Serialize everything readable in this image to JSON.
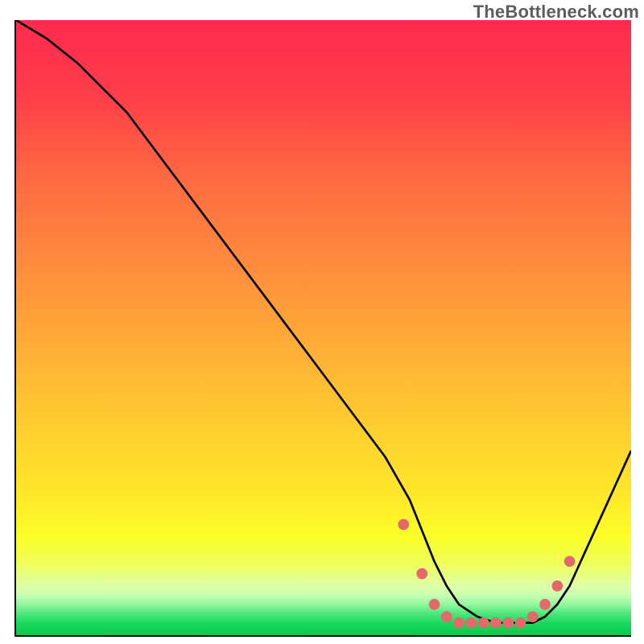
{
  "attribution": "TheBottleneck.com",
  "chart_data": {
    "type": "line",
    "title": "",
    "xlabel": "",
    "ylabel": "",
    "xlim": [
      0,
      100
    ],
    "ylim": [
      0,
      100
    ],
    "series": [
      {
        "name": "curve",
        "x": [
          0,
          5,
          10,
          18,
          30,
          45,
          60,
          64,
          68,
          70,
          72,
          75,
          78,
          80,
          82,
          84,
          86,
          88,
          90,
          100
        ],
        "values": [
          100,
          97,
          93,
          85,
          69,
          49,
          29,
          22,
          12,
          8,
          5,
          3,
          2,
          2,
          2,
          2,
          3,
          5,
          8,
          30
        ]
      }
    ],
    "markers": {
      "name": "salmon-dots",
      "x": [
        63,
        66,
        68,
        70,
        72,
        74,
        76,
        78,
        80,
        82,
        84,
        86,
        88,
        90
      ],
      "values": [
        18,
        10,
        5,
        3,
        2,
        2,
        2,
        2,
        2,
        2,
        3,
        5,
        8,
        12
      ]
    },
    "background": {
      "type": "vertical-gradient",
      "stops": [
        {
          "offset": 0.0,
          "color": "#ff2a4f"
        },
        {
          "offset": 0.12,
          "color": "#ff3d4a"
        },
        {
          "offset": 0.25,
          "color": "#ff6842"
        },
        {
          "offset": 0.4,
          "color": "#ff8c3d"
        },
        {
          "offset": 0.55,
          "color": "#ffb236"
        },
        {
          "offset": 0.68,
          "color": "#ffd22e"
        },
        {
          "offset": 0.78,
          "color": "#ffe92a"
        },
        {
          "offset": 0.84,
          "color": "#fbff28"
        },
        {
          "offset": 0.88,
          "color": "#f0ff54"
        },
        {
          "offset": 0.9,
          "color": "#e8ff7d"
        },
        {
          "offset": 0.92,
          "color": "#deffa7"
        },
        {
          "offset": 0.935,
          "color": "#c8ffb1"
        },
        {
          "offset": 0.95,
          "color": "#93f7a0"
        },
        {
          "offset": 0.965,
          "color": "#4de77a"
        },
        {
          "offset": 0.98,
          "color": "#1bd95c"
        },
        {
          "offset": 1.0,
          "color": "#07c94a"
        }
      ]
    }
  },
  "colors": {
    "curve": "#000000",
    "marker": "#e36a6a",
    "axis": "#000000",
    "attribution": "#5c5c5c"
  }
}
